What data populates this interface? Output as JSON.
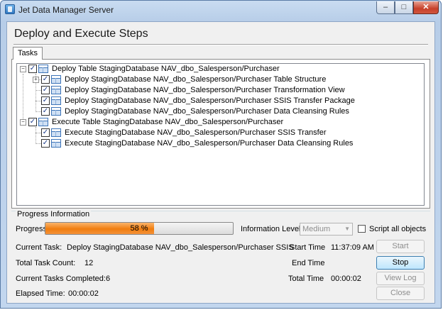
{
  "window": {
    "title": "Jet Data Manager Server",
    "min_glyph": "‒",
    "max_glyph": "□",
    "close_glyph": "✕"
  },
  "heading": "Deploy and Execute Steps",
  "tabs": [
    {
      "label": "Tasks",
      "selected": true
    }
  ],
  "tree": [
    {
      "label": "Deploy Table StagingDatabase NAV_dbo_Salesperson/Purchaser",
      "level": 0,
      "expanded": true,
      "checked": true,
      "children": [
        {
          "label": "Deploy StagingDatabase NAV_dbo_Salesperson/Purchaser Table Structure",
          "expandable": true,
          "checked": true
        },
        {
          "label": "Deploy StagingDatabase NAV_dbo_Salesperson/Purchaser Transformation View",
          "checked": true
        },
        {
          "label": "Deploy StagingDatabase NAV_dbo_Salesperson/Purchaser SSIS Transfer Package",
          "checked": true
        },
        {
          "label": "Deploy StagingDatabase NAV_dbo_Salesperson/Purchaser Data Cleansing Rules",
          "checked": true
        }
      ]
    },
    {
      "label": "Execute Table StagingDatabase NAV_dbo_Salesperson/Purchaser",
      "level": 0,
      "expanded": true,
      "checked": true,
      "children": [
        {
          "label": "Execute StagingDatabase NAV_dbo_Salesperson/Purchaser SSIS Transfer",
          "checked": true
        },
        {
          "label": "Execute StagingDatabase NAV_dbo_Salesperson/Purchaser Data Cleansing Rules",
          "checked": true
        }
      ]
    }
  ],
  "progress": {
    "group_label": "Progress Information",
    "label": "Progress",
    "value_text": "58 %",
    "value": 0.58,
    "fill_color": "#f07d0f"
  },
  "information_level": {
    "label": "Information Level",
    "value": "Medium"
  },
  "script_all": {
    "label": "Script all objects",
    "checked": false
  },
  "status": {
    "current_task_label": "Current Task:",
    "current_task_value": "Deploy StagingDatabase NAV_dbo_Salesperson/Purchaser SSIS",
    "total_task_count_label": "Total Task Count:",
    "total_task_count_value": "12",
    "current_completed_label": "Current Tasks Completed:",
    "current_completed_value": "6",
    "elapsed_label": "Elapsed Time:",
    "elapsed_value": "00:00:02",
    "start_time_label": "Start Time",
    "start_time_value": "11:37:09 AM",
    "end_time_label": "End Time",
    "end_time_value": "",
    "total_time_label": "Total Time",
    "total_time_value": "00:00:02"
  },
  "buttons": {
    "start": "Start",
    "stop": "Stop",
    "view_log": "View Log",
    "close": "Close"
  }
}
